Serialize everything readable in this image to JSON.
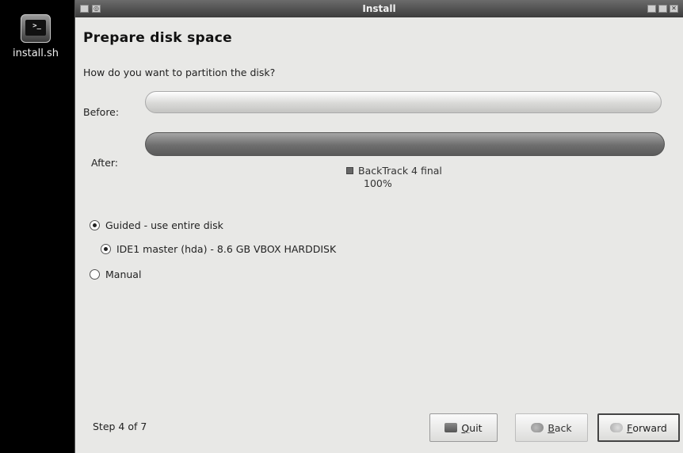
{
  "desktop": {
    "icon_label": "install.sh",
    "icon_glyph": ">_",
    "icon_name": "terminal-icon"
  },
  "window": {
    "title": "Install",
    "heading": "Prepare disk space",
    "question": "How do you want to partition the disk?",
    "before_label": "Before:",
    "after_label": "After:",
    "legend": {
      "name": "BackTrack 4 final",
      "percent": "100%"
    },
    "options": {
      "guided": "Guided - use entire disk",
      "disk": "IDE1 master (hda) - 8.6 GB VBOX HARDDISK",
      "manual": "Manual"
    },
    "selected": [
      "guided",
      "disk"
    ],
    "step": "Step 4 of 7",
    "buttons": {
      "quit_mnemonic": "Q",
      "quit_rest": "uit",
      "back_mnemonic": "B",
      "back_rest": "ack",
      "forward_mnemonic": "F",
      "forward_rest": "orward"
    }
  }
}
